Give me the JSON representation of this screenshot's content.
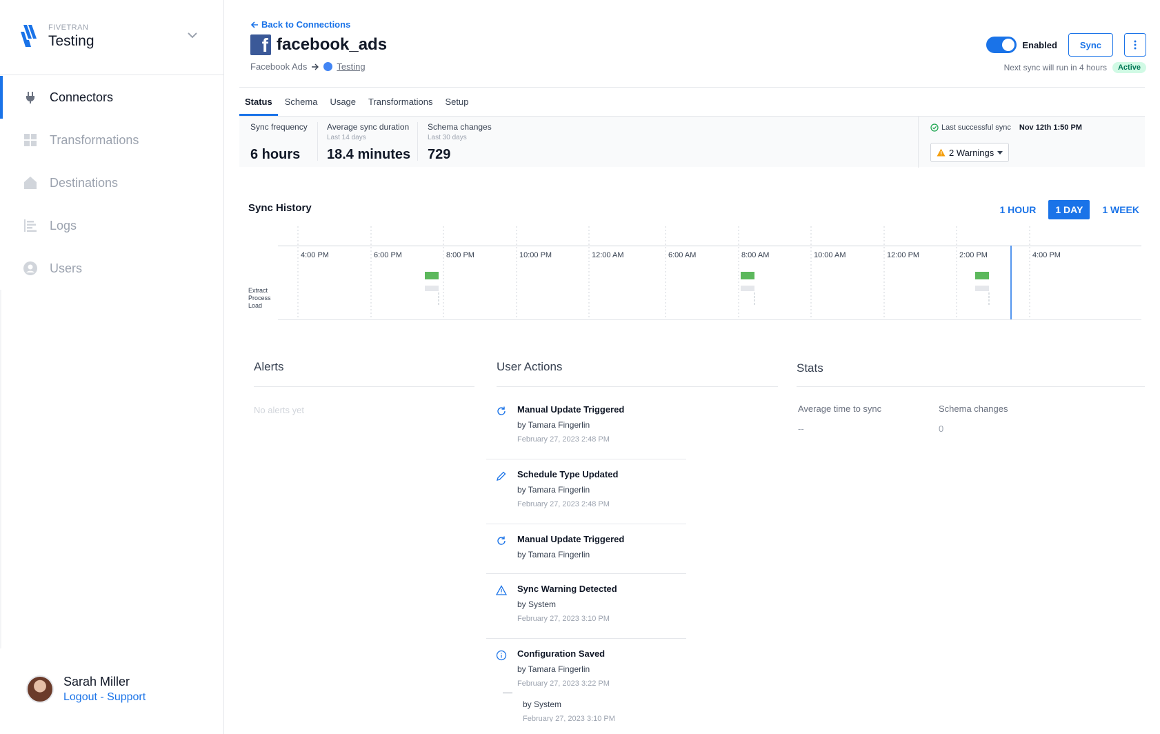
{
  "brand": {
    "small": "FIVETRAN",
    "workspace": "Testing",
    "logo_color": "#1a73e8"
  },
  "nav": [
    {
      "label": "Connectors",
      "icon": "plug-icon",
      "active": true
    },
    {
      "label": "Transformations",
      "icon": "grid-icon",
      "active": false
    },
    {
      "label": "Destinations",
      "icon": "house-icon",
      "active": false
    },
    {
      "label": "Logs",
      "icon": "log-icon",
      "active": false
    },
    {
      "label": "Users",
      "icon": "user-icon",
      "active": false
    }
  ],
  "user": {
    "name": "Sarah Miller",
    "links": "Logout - Support"
  },
  "header": {
    "back": "Back to Connections",
    "title": "facebook_ads",
    "source": "Facebook Ads",
    "destination": "Testing",
    "toggle_label": "Enabled",
    "sync_label": "Sync",
    "next_sync": "Next sync will run in 4 hours",
    "status": "Active"
  },
  "tabs": [
    "Status",
    "Schema",
    "Usage",
    "Transformations",
    "Setup"
  ],
  "stats_bar": {
    "frequency": {
      "label": "Sync frequency",
      "value": "6 hours"
    },
    "duration": {
      "label": "Average sync duration",
      "sub": "Last 14 days",
      "value": "18.4 minutes"
    },
    "schema": {
      "label": "Schema changes",
      "sub": "Last 30 days",
      "value": "729"
    },
    "last_sync_label": "Last successful sync",
    "last_sync_value": "Nov 12th 1:50 PM",
    "warnings": "2 Warnings"
  },
  "sync_history": {
    "title": "Sync History",
    "ranges": [
      "1 HOUR",
      "1 DAY",
      "1 WEEK"
    ],
    "active_range": "1 DAY",
    "time_labels": [
      "4:00 PM",
      "6:00 PM",
      "8:00 PM",
      "10:00 PM",
      "12:00 AM",
      "6:00 AM",
      "8:00 AM",
      "10:00 AM",
      "12:00 PM",
      "2:00 PM",
      "4:00 PM"
    ],
    "row_labels": [
      "Extract",
      "Process",
      "Load"
    ],
    "colors": {
      "extract": "#5cb85c",
      "process": "#e5e7eb",
      "now_line": "#1a73e8"
    }
  },
  "alerts": {
    "title": "Alerts",
    "empty": "No alerts yet"
  },
  "user_actions": {
    "title": "User Actions",
    "items": [
      {
        "icon": "refresh-icon",
        "title": "Manual Update Triggered",
        "by": "by Tamara Fingerlin",
        "date": "February 27, 2023 2:48 PM"
      },
      {
        "icon": "pencil-icon",
        "title": "Schedule Type Updated",
        "by": "by Tamara Fingerlin",
        "date": "February 27, 2023 2:48 PM"
      },
      {
        "icon": "refresh-icon",
        "title": "Manual Update Triggered",
        "by": "by Tamara Fingerlin",
        "date": ""
      },
      {
        "icon": "warning-icon",
        "title": "Sync Warning Detected",
        "by": "by System",
        "date": "February 27, 2023 3:10 PM"
      },
      {
        "icon": "info-icon",
        "title": "Configuration Saved",
        "by": "by Tamara Fingerlin",
        "date": "February 27, 2023 3:22 PM"
      }
    ],
    "partial": {
      "by": "by System",
      "date": "February 27, 2023 3:10 PM"
    }
  },
  "stats": {
    "title": "Stats",
    "avg_label": "Average time to sync",
    "avg_value": "--",
    "schema_label": "Schema changes",
    "schema_value": "0"
  }
}
